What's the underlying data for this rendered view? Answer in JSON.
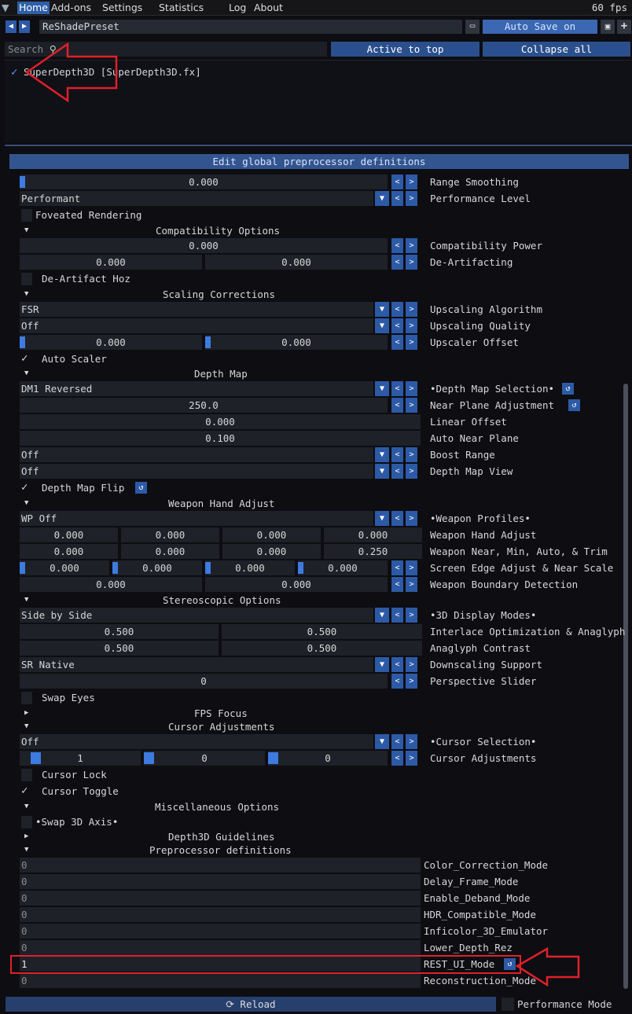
{
  "menubar": {
    "items": [
      "Home",
      "Add-ons",
      "Settings",
      "Statistics",
      "Log",
      "About"
    ],
    "fps": "60 fps"
  },
  "preset": {
    "name": "ReShadePreset",
    "autosave": "Auto Save on"
  },
  "search": {
    "placeholder": "Search",
    "active_to_top": "Active to top",
    "collapse_all": "Collapse all"
  },
  "effect": {
    "name": "SuperDepth3D [SuperDepth3D.fx]",
    "enabled": true
  },
  "global_defs_button": "Edit global preprocessor definitions",
  "params": {
    "range_smoothing": {
      "value": "0.000",
      "label": "Range Smoothing"
    },
    "performance_level": {
      "value": "Performant",
      "label": "Performance Level"
    },
    "foveated": "Foveated Rendering",
    "compat_header": "Compatibility Options",
    "compat_power": {
      "value": "0.000",
      "label": "Compatibility Power"
    },
    "de_artifacting": {
      "v1": "0.000",
      "v2": "0.000",
      "label": "De-Artifacting"
    },
    "de_artifact_hoz": "De-Artifact Hoz",
    "scaling_header": "Scaling Corrections",
    "upscaling_algorithm": {
      "value": "FSR",
      "label": "Upscaling Algorithm"
    },
    "upscaling_quality": {
      "value": "Off",
      "label": "Upscaling Quality"
    },
    "upscaler_offset": {
      "v1": "0.000",
      "v2": "0.000",
      "label": "Upscaler Offset"
    },
    "auto_scaler": "Auto Scaler",
    "depth_header": "Depth Map",
    "depth_map_selection": {
      "value": "DM1 Reversed",
      "label": "•Depth Map Selection•"
    },
    "near_plane": {
      "value": "250.0",
      "label": "Near Plane Adjustment"
    },
    "linear_offset": {
      "value": "0.000",
      "label": "Linear Offset"
    },
    "auto_near_plane": {
      "value": "0.100",
      "label": "Auto Near Plane"
    },
    "boost_range": {
      "value": "Off",
      "label": "Boost Range"
    },
    "depth_map_view": {
      "value": "Off",
      "label": "Depth Map View"
    },
    "depth_map_flip": "Depth Map Flip",
    "weapon_header": "Weapon Hand Adjust",
    "weapon_profiles": {
      "value": "WP Off",
      "label": "•Weapon Profiles•"
    },
    "weapon_hand_adjust": {
      "v": [
        "0.000",
        "0.000",
        "0.000",
        "0.000"
      ],
      "label": "Weapon Hand Adjust"
    },
    "weapon_near": {
      "v": [
        "0.000",
        "0.000",
        "0.000",
        "0.250"
      ],
      "label": "Weapon Near, Min, Auto, & Trim"
    },
    "screen_edge": {
      "v": [
        "0.000",
        "0.000",
        "0.000",
        "0.000"
      ],
      "label": "Screen Edge Adjust & Near Scale"
    },
    "weapon_boundary": {
      "v1": "0.000",
      "v2": "0.000",
      "label": "Weapon Boundary Detection"
    },
    "stereo_header": "Stereoscopic Options",
    "display_modes": {
      "value": "Side by Side",
      "label": "•3D Display Modes•"
    },
    "interlace": {
      "v1": "0.500",
      "v2": "0.500",
      "label": "Interlace Optimization & Anaglyph"
    },
    "anaglyph_contrast": {
      "v1": "0.500",
      "v2": "0.500",
      "label": "Anaglyph Contrast"
    },
    "downscaling": {
      "value": "SR Native",
      "label": "Downscaling Support"
    },
    "perspective": {
      "value": "0",
      "label": "Perspective Slider"
    },
    "swap_eyes": "Swap Eyes",
    "fps_focus": "FPS Focus",
    "cursor_header": "Cursor Adjustments",
    "cursor_selection": {
      "value": "Off",
      "label": "•Cursor Selection•"
    },
    "cursor_adjust": {
      "v": [
        "1",
        "0",
        "0"
      ],
      "label": "Cursor Adjustments"
    },
    "cursor_lock": "Cursor Lock",
    "cursor_toggle": "Cursor Toggle",
    "misc_header": "Miscellaneous Options",
    "swap_3d_axis": "•Swap 3D Axis•",
    "guidelines": "Depth3D Guidelines",
    "preproc_header": "Preprocessor definitions"
  },
  "preprocessor": [
    {
      "value": "0",
      "name": "Color_Correction_Mode"
    },
    {
      "value": "0",
      "name": "Delay_Frame_Mode"
    },
    {
      "value": "0",
      "name": "Enable_Deband_Mode"
    },
    {
      "value": "0",
      "name": "HDR_Compatible_Mode"
    },
    {
      "value": "0",
      "name": "Inficolor_3D_Emulator"
    },
    {
      "value": "0",
      "name": "Lower_Depth_Rez"
    },
    {
      "value": "1",
      "name": "REST_UI_Mode"
    },
    {
      "value": "0",
      "name": "Reconstruction_Mode"
    }
  ],
  "footer": {
    "reload": "Reload",
    "performance_mode": "Performance Mode"
  },
  "colors": {
    "accent": "#2f5aa0",
    "annotation": "#e0202a",
    "check": "#5a9cff"
  }
}
